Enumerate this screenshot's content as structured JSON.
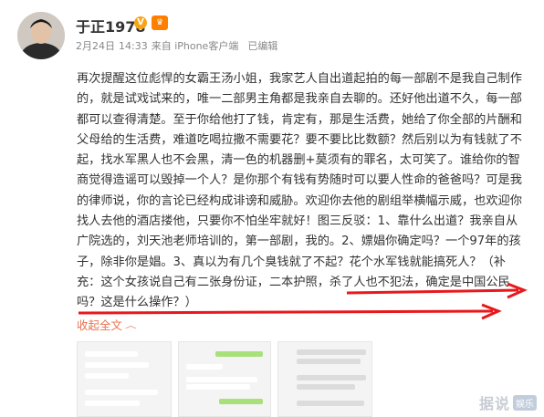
{
  "user": {
    "name": "于正1978",
    "verified_icon": "verified-v-icon",
    "member_icon": "weibo-member-icon"
  },
  "post_meta": {
    "date": "2月24日",
    "time": "14:33",
    "source": "来自 iPhone客户端",
    "edited": "已编辑"
  },
  "post": {
    "text": "再次提醒这位彪悍的女霸王汤小姐，我家艺人自出道起拍的每一部剧不是我自己制作的，就是试戏试来的，唯一二部男主角都是我亲自去聊的。还好他出道不久，每一部都可以查得清楚。至于你给他打了钱，肯定有，那是生活费，她给了你全部的片酬和父母给的生活费，难道吃喝拉撒不需要花？要不要比比数额？然后别以为有钱就了不起，找水军黑人也不会黑，清一色的机器删+莫须有的罪名，太可笑了。谁给你的智商觉得造谣可以毁掉一个人？是你那个有钱有势随时可以要人性命的爸爸吗？可是我的律师说，你的言论已经构成诽谤和威胁。欢迎你去他的剧组举横幅示威，也欢迎你找人去他的酒店搂他，只要你不怕坐牢就好！图三反驳：1、靠什么出道？我亲自从广院选的，刘天池老师培训的，第一部剧，我的。2、嫖娼你确定吗？一个97年的孩子，除非你是娼。3、真以为有几个臭钱就了不起？花个水军钱就能搞死人？（补充：这个女孩说自己有二张身份证，二本护照，杀了人也不犯法，确定是中国公民吗？这是什么操作？）"
  },
  "actions": {
    "collapse_label": "收起全文"
  },
  "colors": {
    "link_orange": "#eb7350",
    "annotation_red": "#e8181c"
  },
  "watermark": {
    "text": "据说",
    "badge": "娱乐"
  }
}
